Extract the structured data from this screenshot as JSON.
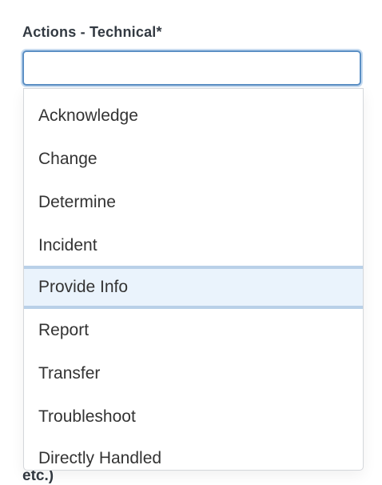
{
  "field": {
    "label": "Actions - Technical*",
    "value": ""
  },
  "dropdown": {
    "options": [
      {
        "label": "Acknowledge"
      },
      {
        "label": "Change"
      },
      {
        "label": "Determine"
      },
      {
        "label": "Incident"
      },
      {
        "label": "Provide Info",
        "highlighted": true
      },
      {
        "label": "Report"
      },
      {
        "label": "Transfer"
      },
      {
        "label": "Troubleshoot"
      },
      {
        "label": "Directly Handled"
      }
    ]
  },
  "background_text": "etc.)",
  "colors": {
    "focus_border": "#5b8fc4",
    "highlight_bg": "#eaf3fc",
    "highlight_border": "#b9d0e8"
  }
}
